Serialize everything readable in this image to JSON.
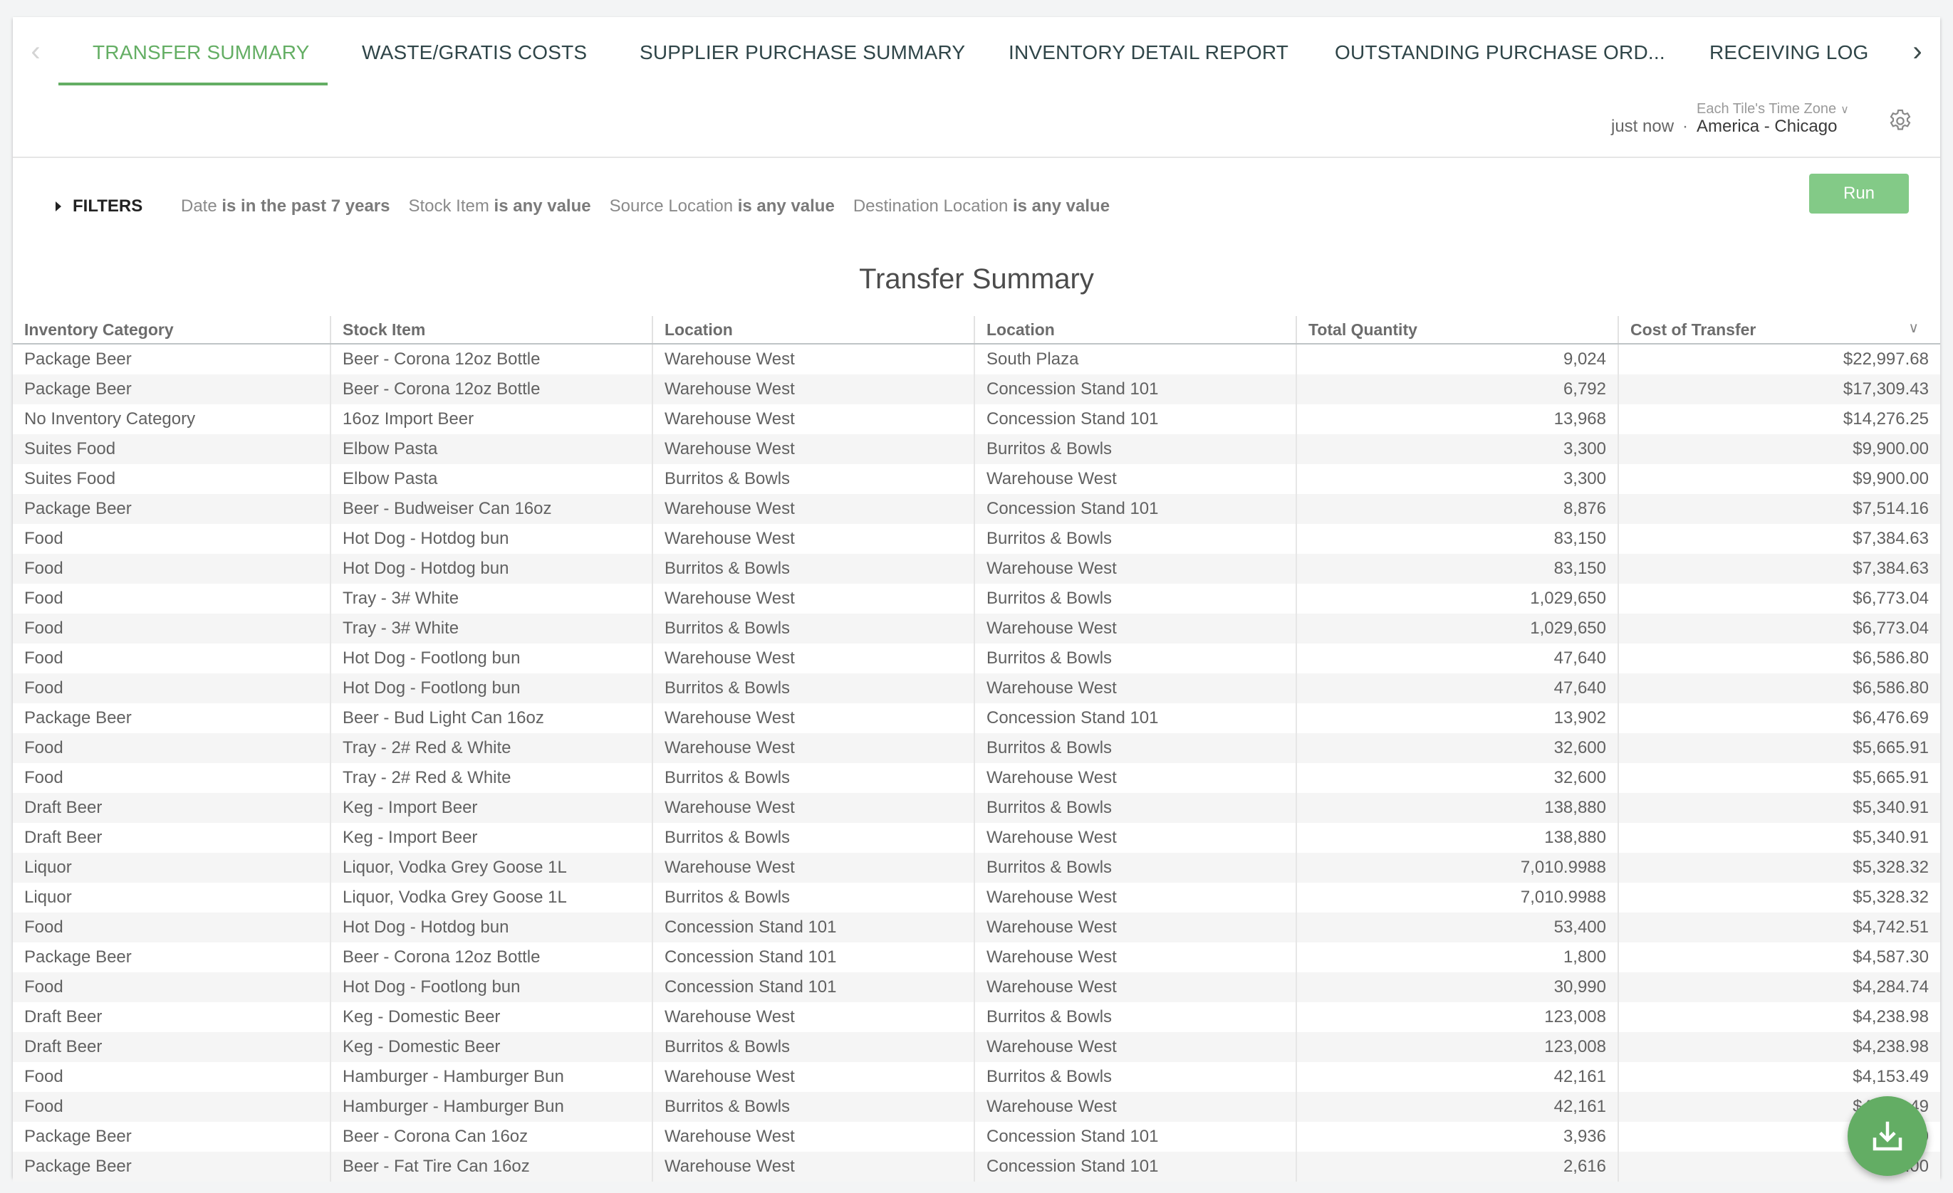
{
  "tabs": [
    {
      "label": "TRANSFER SUMMARY",
      "active": true
    },
    {
      "label": "WASTE/GRATIS COSTS",
      "active": false
    },
    {
      "label": "SUPPLIER PURCHASE SUMMARY",
      "active": false
    },
    {
      "label": "INVENTORY DETAIL REPORT",
      "active": false
    },
    {
      "label": "OUTSTANDING PURCHASE ORD...",
      "active": false
    },
    {
      "label": "RECEIVING LOG",
      "active": false
    }
  ],
  "icons": {
    "tab_prev": "chevron-left-icon",
    "tab_next": "chevron-right-icon",
    "settings": "gear-icon",
    "timezone_caret": "chevron-down-icon",
    "filters_caret": "triangle-right-icon",
    "sort": "chevron-down-icon",
    "download": "download-icon"
  },
  "timezone": {
    "label": "Each Tile's Time Zone",
    "updated": "just now",
    "separator": "·",
    "value": "America - Chicago"
  },
  "filters": {
    "label": "FILTERS",
    "chips": [
      {
        "field": "Date",
        "condition": "is in the past 7 years"
      },
      {
        "field": "Stock Item",
        "condition": "is any value"
      },
      {
        "field": "Source Location",
        "condition": "is any value"
      },
      {
        "field": "Destination Location",
        "condition": "is any value"
      }
    ],
    "run_label": "Run"
  },
  "colors": {
    "accent": "#64ae64",
    "run_button": "#83ca87",
    "fab": "#63ad64"
  },
  "report": {
    "title": "Transfer Summary",
    "columns": [
      "Inventory Category",
      "Stock Item",
      "Location",
      "Location",
      "Total Quantity",
      "Cost of Transfer"
    ],
    "sorted_column": "Cost of Transfer",
    "rows": [
      [
        "Package Beer",
        "Beer - Corona 12oz Bottle",
        "Warehouse West",
        "South Plaza",
        "9,024",
        "$22,997.68"
      ],
      [
        "Package Beer",
        "Beer - Corona 12oz Bottle",
        "Warehouse West",
        "Concession Stand 101",
        "6,792",
        "$17,309.43"
      ],
      [
        "No Inventory Category",
        "16oz Import Beer",
        "Warehouse West",
        "Concession Stand 101",
        "13,968",
        "$14,276.25"
      ],
      [
        "Suites Food",
        "Elbow Pasta",
        "Warehouse West",
        "Burritos & Bowls",
        "3,300",
        "$9,900.00"
      ],
      [
        "Suites Food",
        "Elbow Pasta",
        "Burritos & Bowls",
        "Warehouse West",
        "3,300",
        "$9,900.00"
      ],
      [
        "Package Beer",
        "Beer - Budweiser Can 16oz",
        "Warehouse West",
        "Concession Stand 101",
        "8,876",
        "$7,514.16"
      ],
      [
        "Food",
        "Hot Dog - Hotdog bun",
        "Warehouse West",
        "Burritos & Bowls",
        "83,150",
        "$7,384.63"
      ],
      [
        "Food",
        "Hot Dog - Hotdog bun",
        "Burritos & Bowls",
        "Warehouse West",
        "83,150",
        "$7,384.63"
      ],
      [
        "Food",
        "Tray - 3# White",
        "Warehouse West",
        "Burritos & Bowls",
        "1,029,650",
        "$6,773.04"
      ],
      [
        "Food",
        "Tray - 3# White",
        "Burritos & Bowls",
        "Warehouse West",
        "1,029,650",
        "$6,773.04"
      ],
      [
        "Food",
        "Hot Dog - Footlong bun",
        "Warehouse West",
        "Burritos & Bowls",
        "47,640",
        "$6,586.80"
      ],
      [
        "Food",
        "Hot Dog - Footlong bun",
        "Burritos & Bowls",
        "Warehouse West",
        "47,640",
        "$6,586.80"
      ],
      [
        "Package Beer",
        "Beer - Bud Light Can 16oz",
        "Warehouse West",
        "Concession Stand 101",
        "13,902",
        "$6,476.69"
      ],
      [
        "Food",
        "Tray - 2# Red & White",
        "Warehouse West",
        "Burritos & Bowls",
        "32,600",
        "$5,665.91"
      ],
      [
        "Food",
        "Tray - 2# Red & White",
        "Burritos & Bowls",
        "Warehouse West",
        "32,600",
        "$5,665.91"
      ],
      [
        "Draft Beer",
        "Keg - Import Beer",
        "Warehouse West",
        "Burritos & Bowls",
        "138,880",
        "$5,340.91"
      ],
      [
        "Draft Beer",
        "Keg - Import Beer",
        "Burritos & Bowls",
        "Warehouse West",
        "138,880",
        "$5,340.91"
      ],
      [
        "Liquor",
        "Liquor, Vodka Grey Goose 1L",
        "Warehouse West",
        "Burritos & Bowls",
        "7,010.9988",
        "$5,328.32"
      ],
      [
        "Liquor",
        "Liquor, Vodka Grey Goose 1L",
        "Burritos & Bowls",
        "Warehouse West",
        "7,010.9988",
        "$5,328.32"
      ],
      [
        "Food",
        "Hot Dog - Hotdog bun",
        "Concession Stand 101",
        "Warehouse West",
        "53,400",
        "$4,742.51"
      ],
      [
        "Package Beer",
        "Beer - Corona 12oz Bottle",
        "Concession Stand 101",
        "Warehouse West",
        "1,800",
        "$4,587.30"
      ],
      [
        "Food",
        "Hot Dog - Footlong bun",
        "Concession Stand 101",
        "Warehouse West",
        "30,990",
        "$4,284.74"
      ],
      [
        "Draft Beer",
        "Keg - Domestic Beer",
        "Warehouse West",
        "Burritos & Bowls",
        "123,008",
        "$4,238.98"
      ],
      [
        "Draft Beer",
        "Keg - Domestic Beer",
        "Burritos & Bowls",
        "Warehouse West",
        "123,008",
        "$4,238.98"
      ],
      [
        "Food",
        "Hamburger - Hamburger Bun",
        "Warehouse West",
        "Burritos & Bowls",
        "42,161",
        "$4,153.49"
      ],
      [
        "Food",
        "Hamburger - Hamburger Bun",
        "Burritos & Bowls",
        "Warehouse West",
        "42,161",
        "$4,153.49"
      ],
      [
        "Package Beer",
        "Beer - Corona Can 16oz",
        "Warehouse West",
        "Concession Stand 101",
        "3,936",
        "$...00"
      ],
      [
        "Package Beer",
        "Beer - Fat Tire Can 16oz",
        "Warehouse West",
        "Concession Stand 101",
        "2,616",
        "$...1.00"
      ]
    ]
  }
}
